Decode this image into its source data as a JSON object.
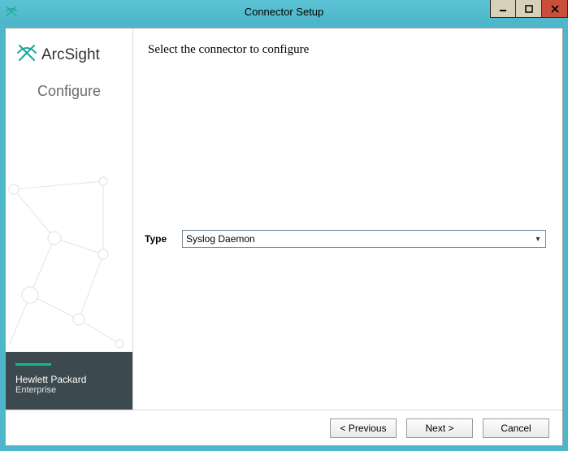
{
  "window": {
    "title": "Connector Setup"
  },
  "sidebar": {
    "brand": "ArcSight",
    "subtitle": "Configure",
    "footer_line1": "Hewlett Packard",
    "footer_line2": "Enterprise"
  },
  "main": {
    "instruction": "Select the connector to configure",
    "type_label": "Type",
    "type_value": "Syslog Daemon"
  },
  "buttons": {
    "previous": "< Previous",
    "next": "Next >",
    "cancel": "Cancel"
  }
}
